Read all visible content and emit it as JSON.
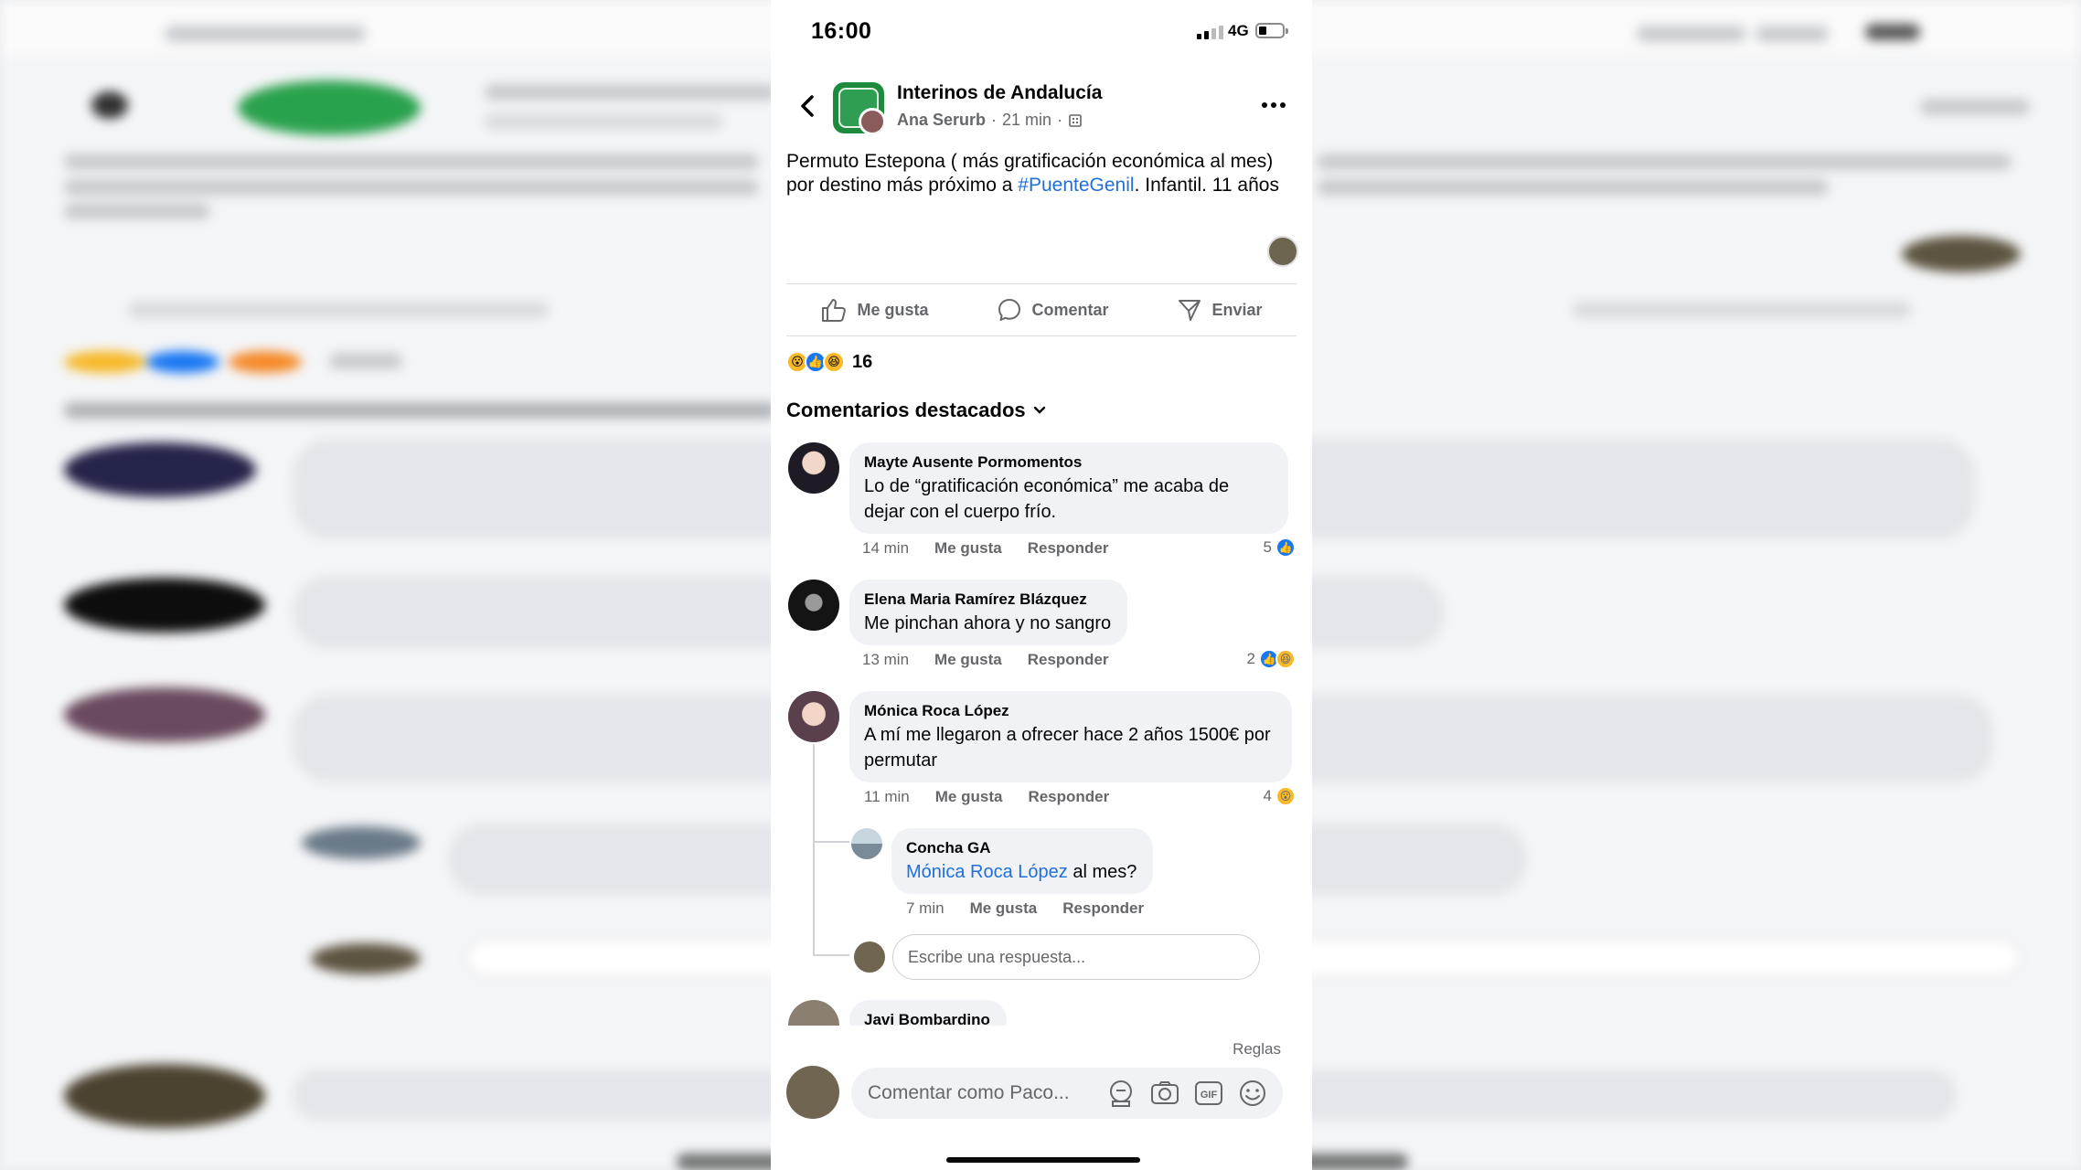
{
  "status": {
    "time": "16:00",
    "network": "4G"
  },
  "post": {
    "group_name": "Interinos de Andalucía",
    "author": "Ana Serurb",
    "time_ago": "21 min",
    "text_before": "Permuto Estepona ( más gratificación económica al mes) por destino más próximo a ",
    "hashtag": "#PuenteGenil",
    "text_after": ". Infantil. 11 años"
  },
  "actions": {
    "like": "Me gusta",
    "comment": "Comentar",
    "send": "Enviar"
  },
  "reactions": {
    "count": "16",
    "types": [
      "wow",
      "like",
      "haha"
    ]
  },
  "comments_section": {
    "title": "Comentarios destacados"
  },
  "comments": [
    {
      "name": "Mayte Ausente Pormomentos",
      "text": "Lo de “gratificación económica” me acaba de dejar con el cuerpo frío.",
      "time": "14 min",
      "like": "Me gusta",
      "reply": "Responder",
      "reaction_count": "5"
    },
    {
      "name": "Elena Maria Ramírez Blázquez",
      "text": "Me pinchan ahora y no sangro",
      "time": "13 min",
      "like": "Me gusta",
      "reply": "Responder",
      "reaction_count": "2"
    },
    {
      "name": "Mónica Roca López",
      "text": "A mí me llegaron a ofrecer hace 2 años 1500€ por permutar",
      "time": "11 min",
      "like": "Me gusta",
      "reply": "Responder",
      "reaction_count": "4"
    },
    {
      "name": "Javi Bombardino"
    }
  ],
  "reply": {
    "name": "Concha GA",
    "mention": "Mónica Roca López",
    "text": " al mes?",
    "time": "7 min",
    "like": "Me gusta",
    "reply": "Responder"
  },
  "reply_input": {
    "placeholder": "Escribe una respuesta..."
  },
  "footer": {
    "rules": "Reglas",
    "composer_placeholder": "Comentar como Paco..."
  },
  "colors": {
    "link": "#216fdb",
    "like_blue": "#1877f2",
    "bubble": "#f0f2f5",
    "secondary_text": "#65676b"
  }
}
